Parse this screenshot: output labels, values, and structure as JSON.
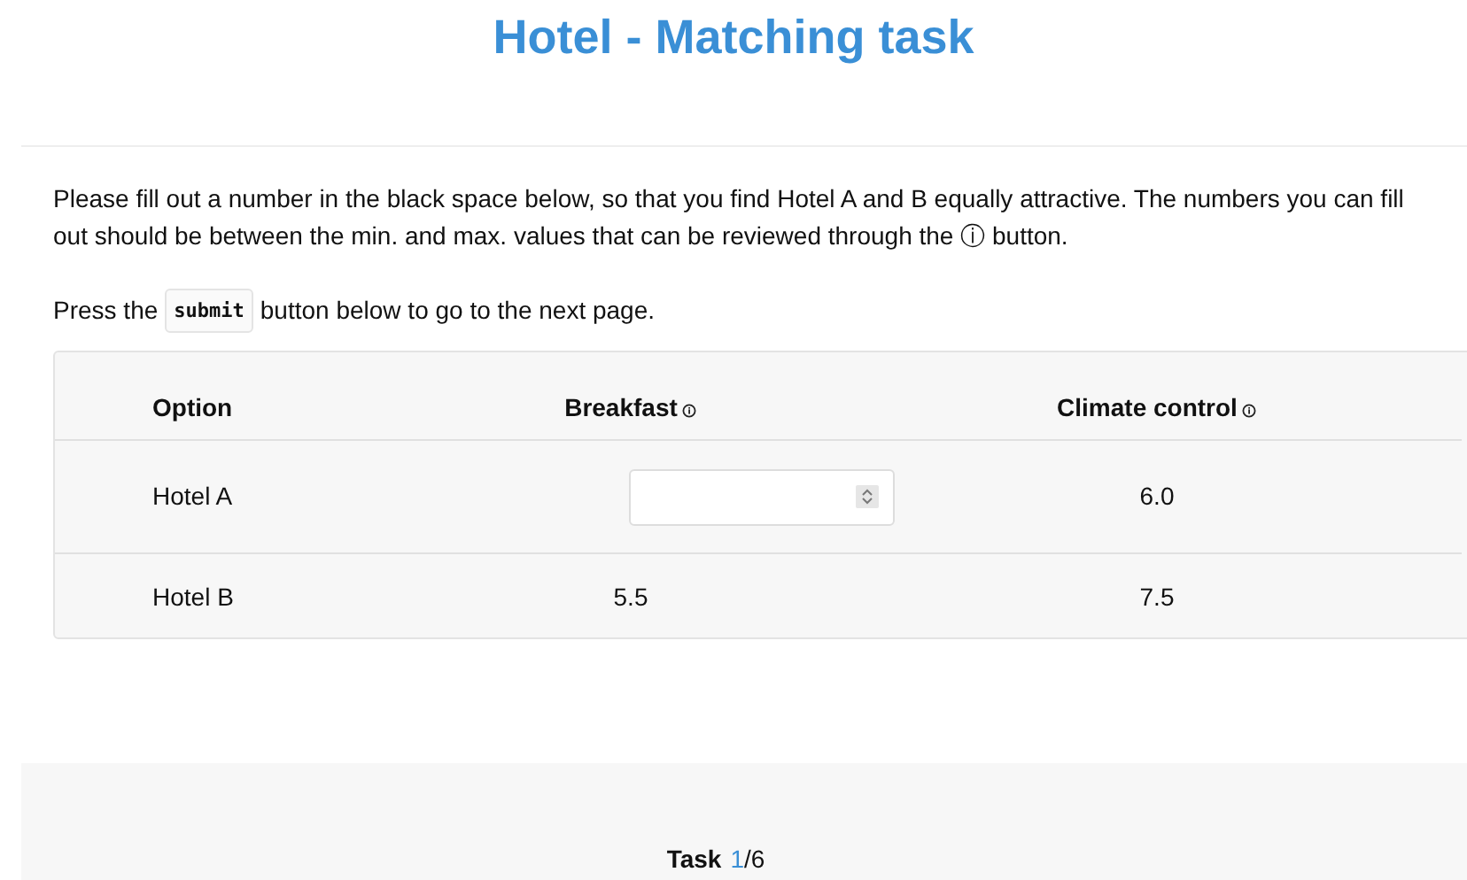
{
  "title": "Hotel - Matching task",
  "instructions": {
    "paragraph": "Please fill out a number in the black space below, so that you find Hotel A and B equally attractive. The numbers you can fill out should be between the min. and max. values that can be reviewed through the ⓘ button.",
    "press_before": "Press the",
    "code": "submit",
    "press_after": "button below to go to the next page."
  },
  "table": {
    "columns": [
      {
        "label": "Option",
        "info": false
      },
      {
        "label": "Breakfast",
        "info": true
      },
      {
        "label": "Climate control",
        "info": true
      }
    ],
    "rows": [
      {
        "cells": [
          {
            "kind": "text",
            "value": "Hotel A"
          },
          {
            "kind": "input"
          },
          {
            "kind": "text",
            "value": "6.0"
          }
        ]
      },
      {
        "cells": [
          {
            "kind": "text",
            "value": "Hotel B"
          },
          {
            "kind": "text",
            "value": "5.5"
          },
          {
            "kind": "text",
            "value": "7.5"
          }
        ]
      }
    ]
  },
  "footer": {
    "label": "Task",
    "current": "1",
    "total": "/6"
  }
}
